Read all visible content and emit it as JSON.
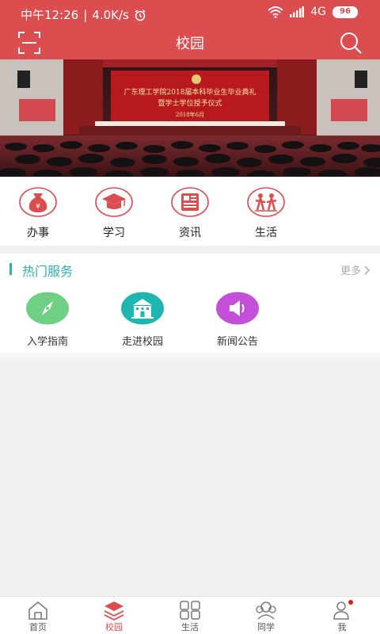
{
  "status_bar": {
    "carrier_time": "中午12:26",
    "separator": "|",
    "speed": "4.0K/s",
    "network": "4G",
    "battery": "96",
    "alarm_icon": "alarm-icon",
    "wifi_icon": "wifi-icon",
    "signal_icon": "signal-icon"
  },
  "header": {
    "title": "校园",
    "left_icon": "scan-icon",
    "right_icon": "search-icon",
    "color": "#db4d4f"
  },
  "banner": {
    "line1": "广东理工学院2018届本科毕业生毕业典礼",
    "line2": "暨学士学位授予仪式",
    "date": "2018年6月"
  },
  "main_menu": [
    {
      "label": "办事",
      "icon": "money-bag-icon"
    },
    {
      "label": "学习",
      "icon": "graduation-cap-icon"
    },
    {
      "label": "资讯",
      "icon": "news-icon"
    },
    {
      "label": "生活",
      "icon": "people-icon"
    }
  ],
  "hot_services": {
    "title": "热门服务",
    "more": "更多",
    "accent": "#2ab3b0",
    "items": [
      {
        "label": "入学指南",
        "icon": "compass-icon",
        "color": "#6fcf84"
      },
      {
        "label": "走进校园",
        "icon": "building-icon",
        "color": "#1fb5b0"
      },
      {
        "label": "新闻公告",
        "icon": "megaphone-icon",
        "color": "#c44fd8"
      }
    ]
  },
  "tab_bar": [
    {
      "label": "首页",
      "icon": "home-icon",
      "active": false
    },
    {
      "label": "校园",
      "icon": "layers-icon",
      "active": true
    },
    {
      "label": "生活",
      "icon": "grid-icon",
      "active": false
    },
    {
      "label": "同学",
      "icon": "classmates-icon",
      "active": false
    },
    {
      "label": "我",
      "icon": "user-icon",
      "active": false,
      "badge": true
    }
  ]
}
